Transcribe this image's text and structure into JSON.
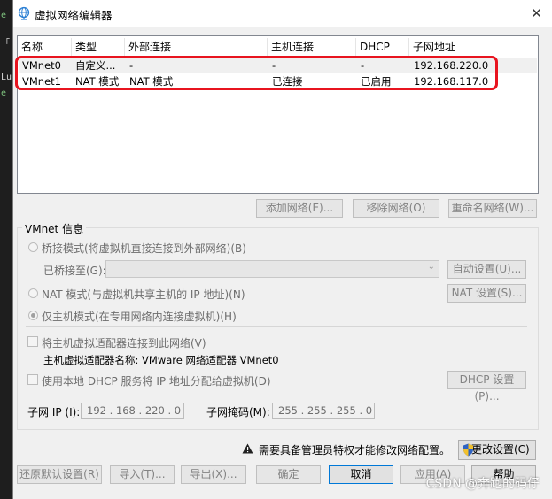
{
  "window": {
    "title": "虚拟网络编辑器",
    "close_glyph": "✕"
  },
  "terminal_strip": {
    "lines": [
      "e",
      "「",
      "Lu",
      "e"
    ]
  },
  "table": {
    "headers": [
      "名称",
      "类型",
      "外部连接",
      "主机连接",
      "DHCP",
      "子网地址"
    ],
    "rows": [
      [
        "VMnet0",
        "自定义...",
        "-",
        "-",
        "-",
        "192.168.220.0"
      ],
      [
        "VMnet1",
        "NAT 模式",
        "NAT 模式",
        "已连接",
        "已启用",
        "192.168.117.0"
      ]
    ]
  },
  "list_buttons": {
    "add": "添加网络(E)...",
    "remove": "移除网络(O)",
    "rename": "重命名网络(W)..."
  },
  "vmnet_info": {
    "group_title": "VMnet 信息",
    "bridge_radio": "桥接模式(将虚拟机直接连接到外部网络)(B)",
    "bridged_to_label": "已桥接至(G):",
    "auto_settings": "自动设置(U)...",
    "nat_radio": "NAT 模式(与虚拟机共享主机的 IP 地址)(N)",
    "nat_settings": "NAT 设置(S)...",
    "host_only_radio": "仅主机模式(在专用网络内连接虚拟机)(H)",
    "connect_adapter_check": "将主机虚拟适配器连接到此网络(V)",
    "adapter_name_label": "主机虚拟适配器名称: VMware 网络适配器 VMnet0",
    "dhcp_check": "使用本地 DHCP 服务将 IP 地址分配给虚拟机(D)",
    "dhcp_settings": "DHCP 设置(P)...",
    "subnet_ip_label": "子网 IP (I):",
    "subnet_ip_value": "192 . 168 . 220 . 0",
    "subnet_mask_label": "子网掩码(M):",
    "subnet_mask_value": "255 . 255 . 255 . 0"
  },
  "admin_notice": {
    "text": "需要具备管理员特权才能修改网络配置。",
    "change_settings": "更改设置(C)"
  },
  "footer_buttons": {
    "restore": "还原默认设置(R)",
    "import": "导入(T)...",
    "export": "导出(X)...",
    "ok": "确定",
    "cancel": "取消",
    "apply": "应用(A)",
    "help": "帮助"
  },
  "watermark": "CSDN @奔跑的码仔",
  "colors": {
    "highlight_box": "#e8141f",
    "accent": "#0078d7"
  }
}
